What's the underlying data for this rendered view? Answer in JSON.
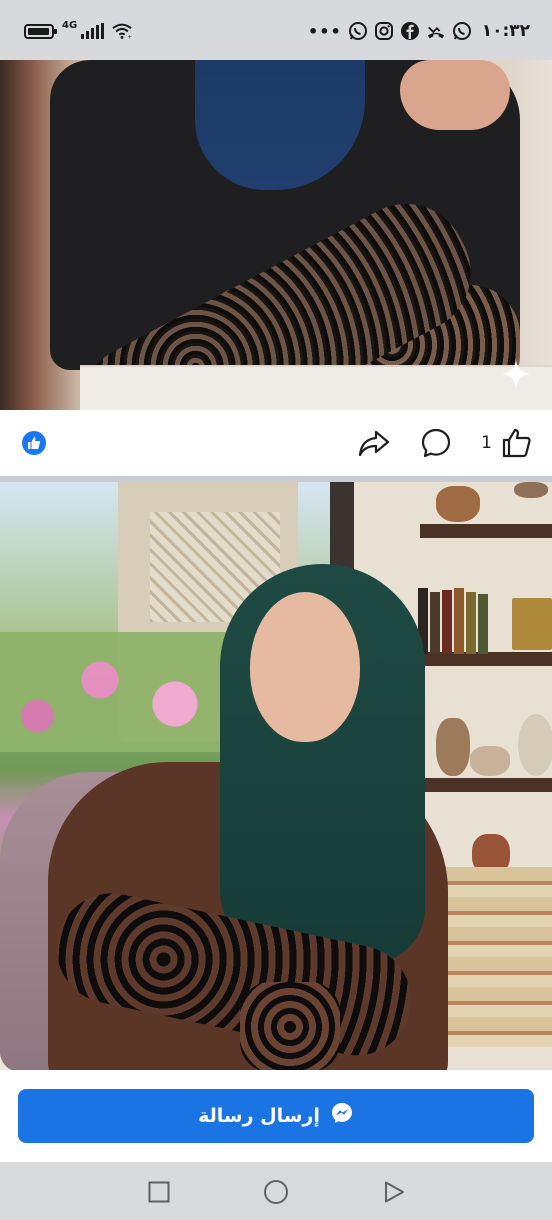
{
  "status_bar": {
    "network_type": "4G",
    "time": "١٠:٣٢",
    "overflow_dots": "•••",
    "notification_icons": [
      "whatsapp-icon",
      "instagram-icon",
      "facebook-icon",
      "missed-call-icon",
      "whatsapp-icon"
    ],
    "left_icons": [
      "battery-icon",
      "signal-icon",
      "wifi-icon"
    ]
  },
  "post1": {
    "image_icon": "sparkle-icon",
    "reactions": {
      "badge_icon": "like-badge-icon",
      "like_count": "1",
      "actions": [
        "share-icon",
        "comment-icon",
        "like-icon"
      ]
    }
  },
  "post2": {
    "image": "photo"
  },
  "cta": {
    "send_message_label": "إرسال رسالة",
    "icon": "messenger-icon"
  },
  "nav_bar": {
    "buttons": [
      "recents-icon",
      "home-icon",
      "back-icon"
    ]
  },
  "colors": {
    "accent": "#1b74e4",
    "badge_blue": "#1877f2",
    "status_bar_bg": "#d8d9dc",
    "nav_bar_bg": "#d9dadc"
  }
}
